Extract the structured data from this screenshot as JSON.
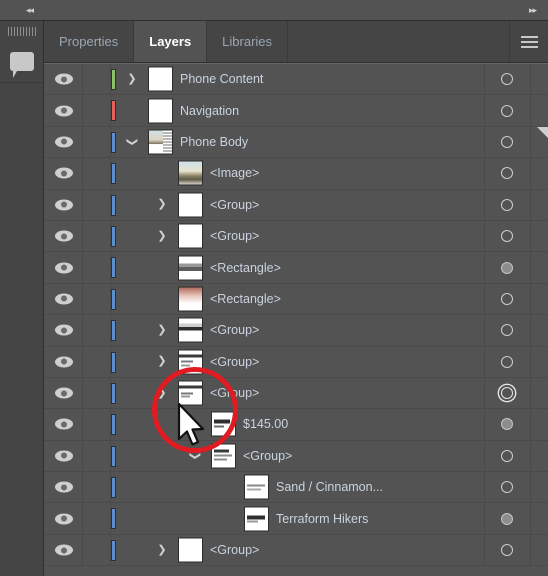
{
  "app": {
    "topbar": {
      "collapse_left_icon": "double-chevron-left-icon",
      "collapse_right_icon": "double-chevron-right-icon"
    },
    "rail": {
      "grip_name": "panel-drag-grip",
      "comment_icon": "comment-bubble-icon"
    },
    "panel": {
      "tabs": [
        {
          "label": "Properties",
          "active": false
        },
        {
          "label": "Layers",
          "active": true
        },
        {
          "label": "Libraries",
          "active": false
        }
      ],
      "menu_icon": "hamburger-menu-icon"
    }
  },
  "colors": {
    "accent_blue": "#5b8ed0",
    "annotation_red": "#e01b22",
    "layer_green": "#8cc26a",
    "layer_red": "#e8605a",
    "layer_blue": "#5b8ed0",
    "panel_bg": "#535353",
    "tab_bg": "#454545",
    "label_text": "#c9d4e0"
  },
  "layers": [
    {
      "name": "Phone Content",
      "indent": 0,
      "color": "#8cc26a",
      "disclosure": "closed",
      "thumb": "blank",
      "target": "hollow",
      "selected": false,
      "corner": false
    },
    {
      "name": "Navigation",
      "indent": 0,
      "color": "#e8605a",
      "disclosure": "none",
      "thumb": "blank",
      "target": "hollow",
      "selected": false,
      "corner": false
    },
    {
      "name": "Phone Body",
      "indent": 0,
      "color": "#5b8ed0",
      "disclosure": "open",
      "thumb": "photo-ui",
      "target": "hollow",
      "selected": true,
      "corner": true
    },
    {
      "name": "<Image>",
      "indent": 1,
      "color": "#5b8ed0",
      "disclosure": "none",
      "thumb": "photo",
      "target": "hollow",
      "selected": false,
      "corner": false
    },
    {
      "name": "<Group>",
      "indent": 1,
      "color": "#5b8ed0",
      "disclosure": "closed",
      "thumb": "blank",
      "target": "hollow",
      "selected": false,
      "corner": false
    },
    {
      "name": "<Group>",
      "indent": 1,
      "color": "#5b8ed0",
      "disclosure": "closed",
      "thumb": "blank",
      "target": "hollow",
      "selected": false,
      "corner": false
    },
    {
      "name": "<Rectangle>",
      "indent": 1,
      "color": "#5b8ed0",
      "disclosure": "none",
      "thumb": "bars-gray",
      "target": "filled",
      "selected": false,
      "corner": false
    },
    {
      "name": "<Rectangle>",
      "indent": 1,
      "color": "#5b8ed0",
      "disclosure": "none",
      "thumb": "gradient-red",
      "target": "hollow",
      "selected": false,
      "corner": false
    },
    {
      "name": "<Group>",
      "indent": 1,
      "color": "#5b8ed0",
      "disclosure": "closed",
      "thumb": "bars-dark",
      "target": "hollow",
      "selected": false,
      "corner": false
    },
    {
      "name": "<Group>",
      "indent": 1,
      "color": "#5b8ed0",
      "disclosure": "closed",
      "thumb": "bars-mixed",
      "target": "hollow",
      "selected": false,
      "corner": false
    },
    {
      "name": "<Group>",
      "indent": 1,
      "color": "#5b8ed0",
      "disclosure": "closed",
      "thumb": "bars-mixed",
      "target": "ring",
      "selected": true,
      "corner": false
    },
    {
      "name": "$145.00",
      "indent": 2,
      "color": "#5b8ed0",
      "disclosure": "none",
      "thumb": "text-price",
      "target": "filled",
      "selected": true,
      "corner": false
    },
    {
      "name": "<Group>",
      "indent": 2,
      "color": "#5b8ed0",
      "disclosure": "open",
      "thumb": "text-lines",
      "target": "hollow",
      "selected": true,
      "corner": false
    },
    {
      "name": "Sand / Cinnamon...",
      "indent": 3,
      "color": "#5b8ed0",
      "disclosure": "none",
      "thumb": "text-thin",
      "target": "hollow",
      "selected": true,
      "corner": false
    },
    {
      "name": "Terraform Hikers",
      "indent": 3,
      "color": "#5b8ed0",
      "disclosure": "none",
      "thumb": "text-bold",
      "target": "filled",
      "selected": true,
      "corner": false
    },
    {
      "name": "<Group>",
      "indent": 1,
      "color": "#5b8ed0",
      "disclosure": "closed",
      "thumb": "blank",
      "target": "hollow",
      "selected": false,
      "corner": false
    }
  ],
  "annotation": {
    "highlight_circle_name": "annotation-circle",
    "cursor_name": "mouse-cursor"
  }
}
